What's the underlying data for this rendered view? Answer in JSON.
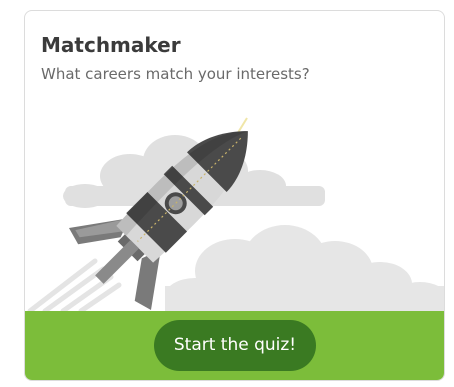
{
  "card": {
    "title": "Matchmaker",
    "subtitle": "What careers match your interests?",
    "illustration_icon": "rocket-icon"
  },
  "footer": {
    "button_label": "Start the quiz!"
  },
  "colors": {
    "footer_green": "#7cbd3a",
    "button_green": "#3a7a22",
    "rocket_dark": "#4a4a4a",
    "rocket_light": "#d9d9d9",
    "cloud": "#e3e3e3"
  }
}
